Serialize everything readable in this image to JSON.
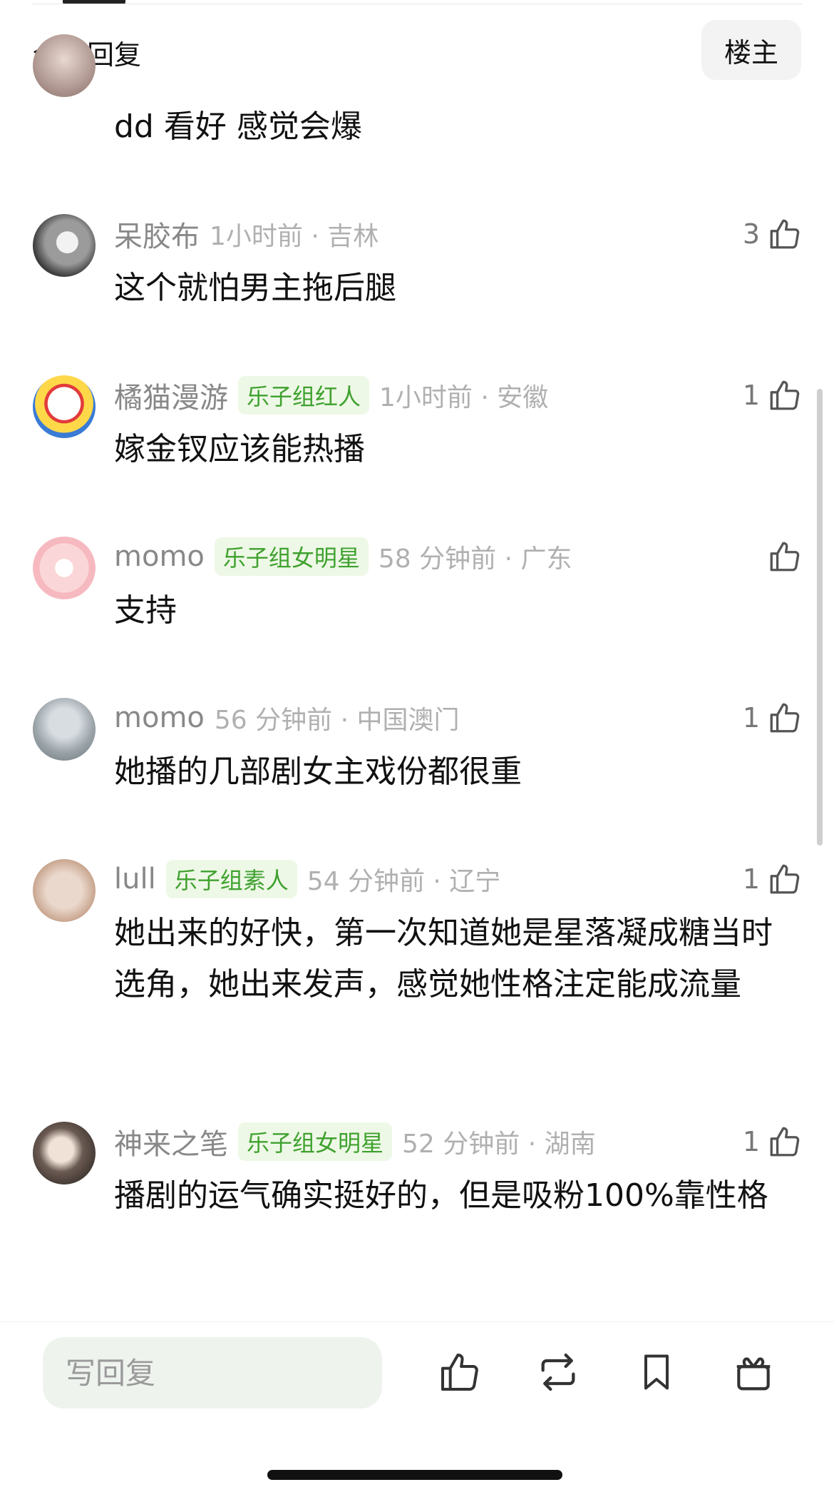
{
  "header": {
    "title": "全部回复",
    "owner_button": "楼主"
  },
  "comments": [
    {
      "user": "",
      "badge": "",
      "time_location": "",
      "likes": "",
      "text": "dd 看好 感觉会爆",
      "avatar": "partial-avatar"
    },
    {
      "user": "呆胶布",
      "badge": "",
      "time_location": "1小时前 · 吉林",
      "likes": "3",
      "text": "这个就怕男主拖后腿",
      "avatar": "cat-photo-avatar"
    },
    {
      "user": "橘猫漫游",
      "badge": "乐子组红人",
      "time_location": "1小时前 · 安徽",
      "likes": "1",
      "text": "嫁金钗应该能热播",
      "avatar": "hello-kitty-avatar"
    },
    {
      "user": "momo",
      "badge": "乐子组女明星",
      "time_location": "58 分钟前 · 广东",
      "likes": "",
      "text": "支持",
      "avatar": "pink-cartoon-avatar"
    },
    {
      "user": "momo",
      "badge": "",
      "time_location": "56 分钟前 · 中国澳门",
      "likes": "1",
      "text": "她播的几部剧女主戏份都很重",
      "avatar": "tree-photo-avatar"
    },
    {
      "user": "lull",
      "badge": "乐子组素人",
      "time_location": "54 分钟前 · 辽宁",
      "likes": "1",
      "text": "她出来的好快，第一次知道她是星落凝成糖当时选角，她出来发声，感觉她性格注定能成流量",
      "avatar": "sketch-avatar"
    },
    {
      "user": "神来之笔",
      "badge": "乐子组女明星",
      "time_location": "52 分钟前 · 湖南",
      "likes": "1",
      "text": "播剧的运气确实挺好的，但是吸粉100%靠性格",
      "avatar": "portrait-avatar"
    }
  ],
  "bottom_bar": {
    "reply_placeholder": "写回复",
    "icons": [
      "like-icon",
      "repost-icon",
      "bookmark-icon",
      "gift-icon"
    ]
  },
  "colors": {
    "badge_text": "#3fa12f",
    "badge_bg": "#eef8e6",
    "meta_text": "#b0b0b0",
    "input_bg": "#eef3ee"
  }
}
